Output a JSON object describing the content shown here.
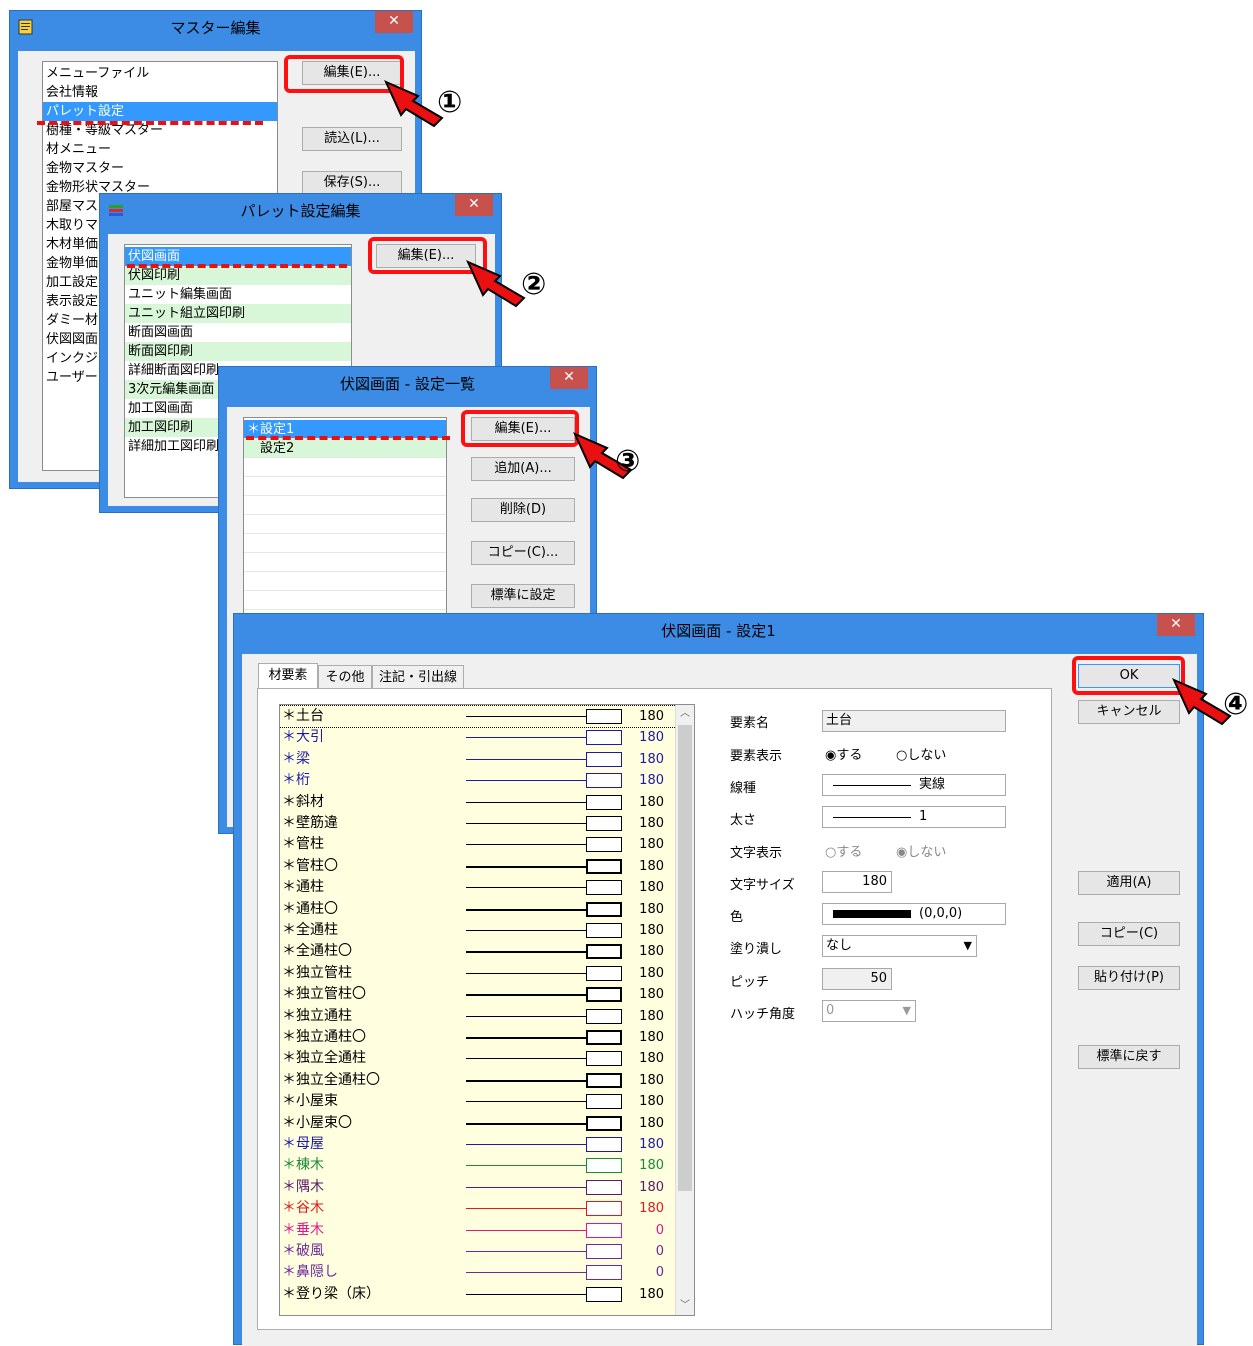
{
  "win1": {
    "title": "マスター編集",
    "items": [
      "メニューファイル",
      "会社情報",
      "パレット設定",
      "樹種・等級マスター",
      "材メニュー",
      "金物マスター",
      "金物形状マスター",
      "部屋マスター",
      "木取りマスター",
      "木材単価",
      "金物単価",
      "加工設定",
      "表示設定",
      "ダミー材マスター",
      "伏図図面",
      "インクジェット",
      "ユーザー"
    ],
    "buttons": {
      "edit": "編集(E)...",
      "load": "読込(L)...",
      "save": "保存(S)..."
    }
  },
  "win2": {
    "title": "パレット設定編集",
    "items": [
      "伏図画面",
      "伏図印刷",
      "ユニット編集画面",
      "ユニット組立図印刷",
      "断面図画面",
      "断面図印刷",
      "詳細断面図印刷",
      "3次元編集画面",
      "加工図画面",
      "加工図印刷",
      "詳細加工図印刷"
    ],
    "buttons": {
      "edit": "編集(E)..."
    }
  },
  "win3": {
    "title": "伏図画面 - 設定一覧",
    "items": [
      "＊設定1",
      "設定2"
    ],
    "buttons": {
      "edit": "編集(E)...",
      "add": "追加(A)...",
      "delete": "削除(D)",
      "copy": "コピー(C)...",
      "standard": "標準に設定"
    }
  },
  "win4": {
    "title": "伏図画面 - 設定1",
    "tabs": [
      "材要素",
      "その他",
      "注記・引出線"
    ],
    "palette": [
      {
        "name": "＊土台",
        "num": "180",
        "color": "#000000",
        "weight": 1
      },
      {
        "name": "＊大引",
        "num": "180",
        "color": "#1a1aa6",
        "weight": 1
      },
      {
        "name": "＊梁",
        "num": "180",
        "color": "#1a1aa6",
        "weight": 1
      },
      {
        "name": "＊桁",
        "num": "180",
        "color": "#1a1aa6",
        "weight": 1
      },
      {
        "name": "＊斜材",
        "num": "180",
        "color": "#000000",
        "weight": 1
      },
      {
        "name": "＊壁筋違",
        "num": "180",
        "color": "#000000",
        "weight": 1
      },
      {
        "name": "＊管柱",
        "num": "180",
        "color": "#000000",
        "weight": 1
      },
      {
        "name": "＊管柱〇",
        "num": "180",
        "color": "#000000",
        "weight": 2
      },
      {
        "name": "＊通柱",
        "num": "180",
        "color": "#000000",
        "weight": 1
      },
      {
        "name": "＊通柱〇",
        "num": "180",
        "color": "#000000",
        "weight": 2
      },
      {
        "name": "＊全通柱",
        "num": "180",
        "color": "#000000",
        "weight": 1
      },
      {
        "name": "＊全通柱〇",
        "num": "180",
        "color": "#000000",
        "weight": 2
      },
      {
        "name": "＊独立管柱",
        "num": "180",
        "color": "#000000",
        "weight": 1
      },
      {
        "name": "＊独立管柱〇",
        "num": "180",
        "color": "#000000",
        "weight": 2
      },
      {
        "name": "＊独立通柱",
        "num": "180",
        "color": "#000000",
        "weight": 1
      },
      {
        "name": "＊独立通柱〇",
        "num": "180",
        "color": "#000000",
        "weight": 2
      },
      {
        "name": "＊独立全通柱",
        "num": "180",
        "color": "#000000",
        "weight": 1
      },
      {
        "name": "＊独立全通柱〇",
        "num": "180",
        "color": "#000000",
        "weight": 2
      },
      {
        "name": "＊小屋束",
        "num": "180",
        "color": "#000000",
        "weight": 1
      },
      {
        "name": "＊小屋束〇",
        "num": "180",
        "color": "#000000",
        "weight": 2
      },
      {
        "name": "＊母屋",
        "num": "180",
        "color": "#1a1aa6",
        "weight": 1
      },
      {
        "name": "＊棟木",
        "num": "180",
        "color": "#1a8a3a",
        "weight": 1
      },
      {
        "name": "＊隅木",
        "num": "180",
        "color": "#5a1a6a",
        "weight": 1
      },
      {
        "name": "＊谷木",
        "num": "180",
        "color": "#e01a1a",
        "weight": 1
      },
      {
        "name": "＊垂木",
        "num": "0",
        "color": "#e0178a",
        "weight": 1
      },
      {
        "name": "＊破風",
        "num": "0",
        "color": "#6a2a9a",
        "weight": 1
      },
      {
        "name": "＊鼻隠し",
        "num": "0",
        "color": "#6a2a9a",
        "weight": 1
      },
      {
        "name": "＊登り梁（床）",
        "num": "180",
        "color": "#000000",
        "weight": 1
      }
    ],
    "fields": {
      "element_name_label": "要素名",
      "element_name_value": "土台",
      "element_display_label": "要素表示",
      "display_on": "する",
      "display_off": "しない",
      "line_type_label": "線種",
      "line_type_value": "実線",
      "thickness_label": "太さ",
      "thickness_value": "1",
      "text_display_label": "文字表示",
      "text_on": "する",
      "text_off": "しない",
      "text_size_label": "文字サイズ",
      "text_size_value": "180",
      "color_label": "色",
      "color_value": "(0,0,0)",
      "fill_label": "塗り潰し",
      "fill_value": "なし",
      "pitch_label": "ピッチ",
      "pitch_value": "50",
      "hatch_label": "ハッチ角度",
      "hatch_value": "0"
    },
    "buttons": {
      "ok": "OK",
      "cancel": "キャンセル",
      "apply": "適用(A)",
      "copy": "コピー(C)",
      "paste": "貼り付け(P)",
      "reset": "標準に戻す"
    }
  },
  "markers": [
    "①",
    "②",
    "③",
    "④"
  ]
}
